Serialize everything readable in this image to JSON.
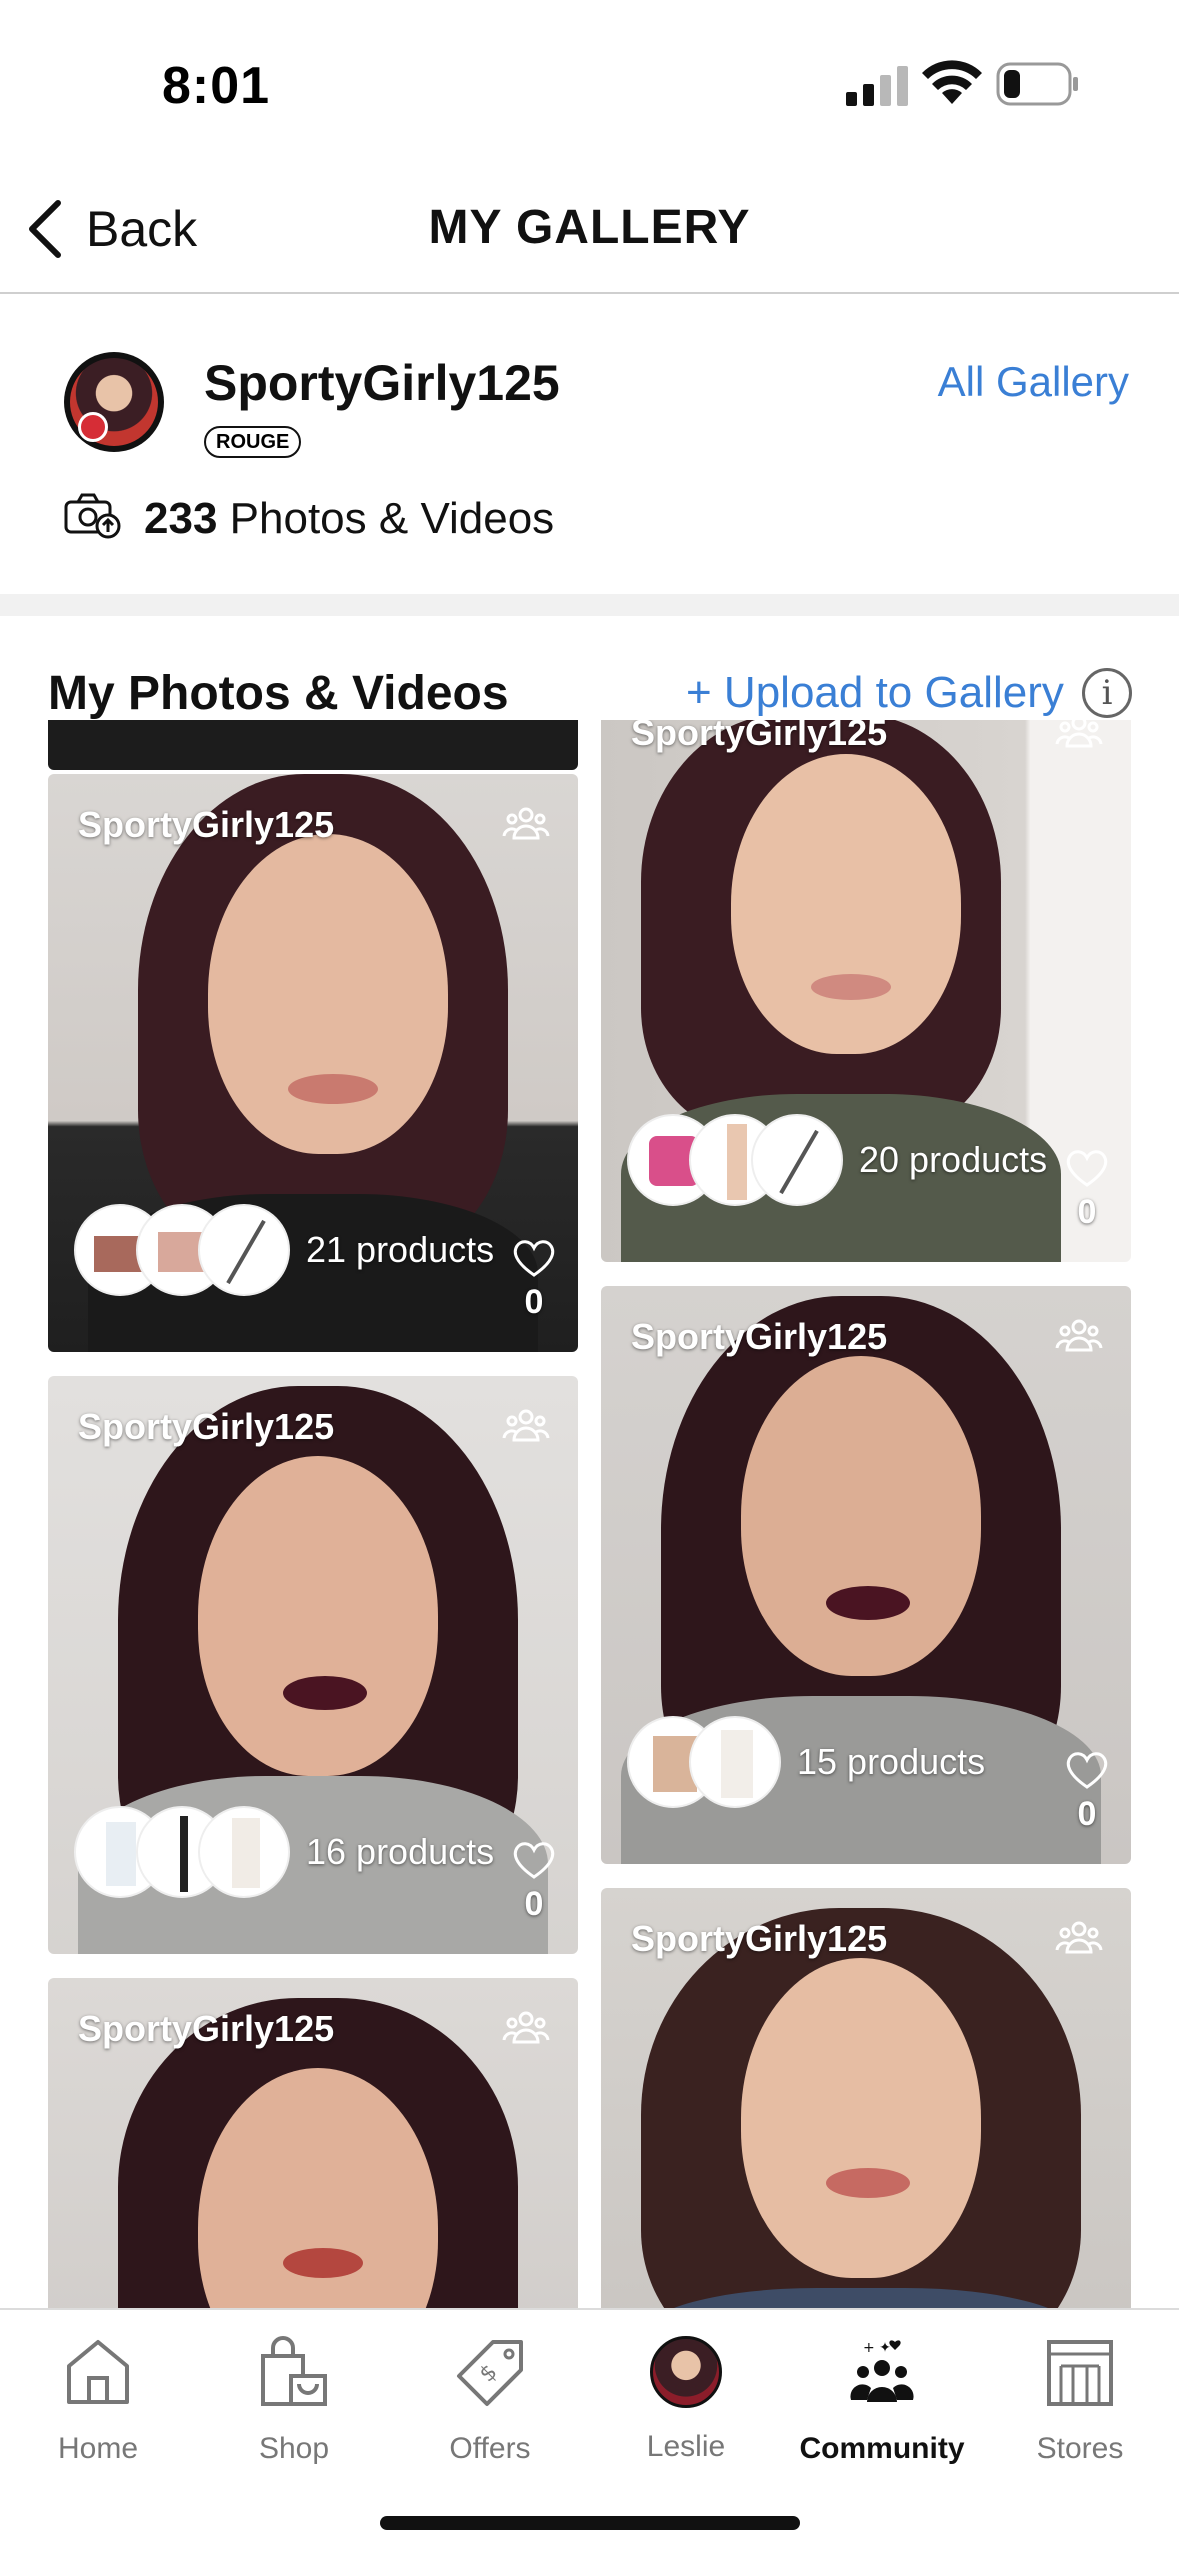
{
  "status_bar": {
    "time": "8:01"
  },
  "nav": {
    "back_label": "Back",
    "title": "MY GALLERY"
  },
  "profile": {
    "username": "SportyGirly125",
    "tier": "ROUGE",
    "all_gallery_label": "All Gallery",
    "media_count": "233",
    "media_label": "Photos & Videos"
  },
  "gallery": {
    "title": "My Photos & Videos",
    "upload_label": "+ Upload to Gallery",
    "info_label": "i",
    "cards": [
      {
        "user": "SportyGirly125",
        "products": "21 products",
        "likes": "0"
      },
      {
        "user": "SportyGirly125",
        "products": "20 products",
        "likes": "0"
      },
      {
        "user": "SportyGirly125",
        "products": "16 products",
        "likes": "0"
      },
      {
        "user": "SportyGirly125",
        "products": "15 products",
        "likes": "0"
      },
      {
        "user": "SportyGirly125",
        "products": "",
        "likes": ""
      },
      {
        "user": "SportyGirly125",
        "products": "",
        "likes": ""
      }
    ]
  },
  "tab_bar": {
    "items": [
      {
        "label": "Home",
        "icon": "home-icon"
      },
      {
        "label": "Shop",
        "icon": "shop-bag-icon"
      },
      {
        "label": "Offers",
        "icon": "offers-tag-icon"
      },
      {
        "label": "Leslie",
        "icon": "avatar"
      },
      {
        "label": "Community",
        "icon": "community-icon"
      },
      {
        "label": "Stores",
        "icon": "stores-icon"
      }
    ],
    "active": "Community"
  },
  "colors": {
    "link_blue": "#3a7fd5",
    "text": "#111111",
    "divider": "#cfcfcf"
  }
}
